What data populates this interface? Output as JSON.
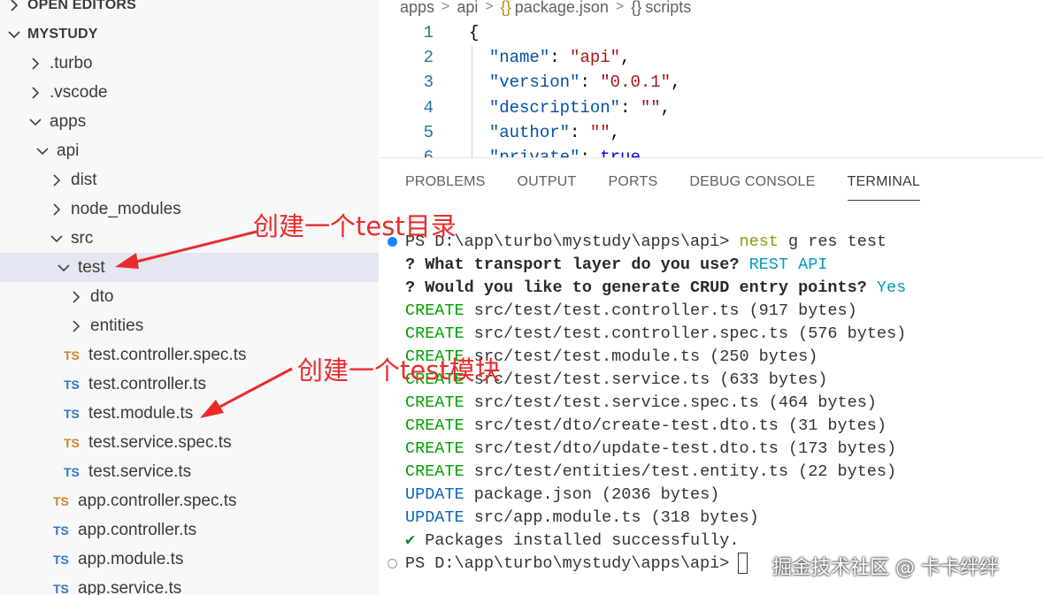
{
  "explorer": {
    "open_editors_label": "OPEN EDITORS",
    "workspace_label": "MYSTUDY",
    "items": [
      {
        "label": ".turbo",
        "type": "folder",
        "expanded": false
      },
      {
        "label": ".vscode",
        "type": "folder",
        "expanded": false
      },
      {
        "label": "apps",
        "type": "folder",
        "expanded": true
      },
      {
        "label": "api",
        "type": "folder",
        "expanded": true
      },
      {
        "label": "dist",
        "type": "folder",
        "expanded": false
      },
      {
        "label": "node_modules",
        "type": "folder",
        "expanded": false
      },
      {
        "label": "src",
        "type": "folder",
        "expanded": true
      },
      {
        "label": "test",
        "type": "folder",
        "expanded": true,
        "selected": true
      },
      {
        "label": "dto",
        "type": "folder",
        "expanded": false
      },
      {
        "label": "entities",
        "type": "folder",
        "expanded": false
      },
      {
        "label": "test.controller.spec.ts",
        "type": "file",
        "badge": "TS",
        "badge_color": "#d18227"
      },
      {
        "label": "test.controller.ts",
        "type": "file",
        "badge": "TS",
        "badge_color": "#3178c6"
      },
      {
        "label": "test.module.ts",
        "type": "file",
        "badge": "TS",
        "badge_color": "#3178c6"
      },
      {
        "label": "test.service.spec.ts",
        "type": "file",
        "badge": "TS",
        "badge_color": "#d18227"
      },
      {
        "label": "test.service.ts",
        "type": "file",
        "badge": "TS",
        "badge_color": "#3178c6"
      },
      {
        "label": "app.controller.spec.ts",
        "type": "file",
        "badge": "TS",
        "badge_color": "#d18227"
      },
      {
        "label": "app.controller.ts",
        "type": "file",
        "badge": "TS",
        "badge_color": "#3178c6"
      },
      {
        "label": "app.module.ts",
        "type": "file",
        "badge": "TS",
        "badge_color": "#3178c6"
      },
      {
        "label": "app.service.ts",
        "type": "file",
        "badge": "TS",
        "badge_color": "#3178c6"
      }
    ]
  },
  "editor": {
    "breadcrumb": [
      "apps",
      "api",
      "package.json",
      "scripts"
    ],
    "breadcrumb_icons": [
      "{}",
      "{}"
    ],
    "lines": [
      {
        "num": "1",
        "text": "{"
      },
      {
        "num": "2",
        "key": "\"name\"",
        "value": "\"api\""
      },
      {
        "num": "3",
        "key": "\"version\"",
        "value": "\"0.0.1\""
      },
      {
        "num": "4",
        "key": "\"description\"",
        "value": "\"\""
      },
      {
        "num": "5",
        "key": "\"author\"",
        "value": "\"\""
      },
      {
        "num": "6",
        "key": "\"private\"",
        "value": "true"
      }
    ]
  },
  "panel": {
    "tabs": [
      "PROBLEMS",
      "OUTPUT",
      "PORTS",
      "DEBUG CONSOLE",
      "TERMINAL"
    ],
    "active_tab": "TERMINAL",
    "terminal": {
      "prompt": "PS D:\\app\\turbo\\mystudy\\apps\\api>",
      "command_name": "nest",
      "command_args": "g res test",
      "q1": "? What transport layer do you use?",
      "a1": "REST API",
      "q2": "? Would you like to generate CRUD entry points?",
      "a2": "Yes",
      "actions": [
        {
          "kind": "CREATE",
          "text": "src/test/test.controller.ts (917 bytes)"
        },
        {
          "kind": "CREATE",
          "text": "src/test/test.controller.spec.ts (576 bytes)"
        },
        {
          "kind": "CREATE",
          "text": "src/test/test.module.ts (250 bytes)"
        },
        {
          "kind": "CREATE",
          "text": "src/test/test.service.ts (633 bytes)"
        },
        {
          "kind": "CREATE",
          "text": "src/test/test.service.spec.ts (464 bytes)"
        },
        {
          "kind": "CREATE",
          "text": "src/test/dto/create-test.dto.ts (31 bytes)"
        },
        {
          "kind": "CREATE",
          "text": "src/test/dto/update-test.dto.ts (173 bytes)"
        },
        {
          "kind": "CREATE",
          "text": "src/test/entities/test.entity.ts (22 bytes)"
        },
        {
          "kind": "UPDATE",
          "text": "package.json (2036 bytes)"
        },
        {
          "kind": "UPDATE",
          "text": "src/app.module.ts (318 bytes)"
        }
      ],
      "success_mark": "✔",
      "success_text": "Packages installed successfully.",
      "final_prompt": "PS D:\\app\\turbo\\mystudy\\apps\\api>"
    }
  },
  "annotations": {
    "folder_note": "创建一个test目录",
    "module_note": "创建一个test模块",
    "color": "#ea2b2b"
  },
  "watermark": "掘金技术社区 @ 卡卡绊绊"
}
